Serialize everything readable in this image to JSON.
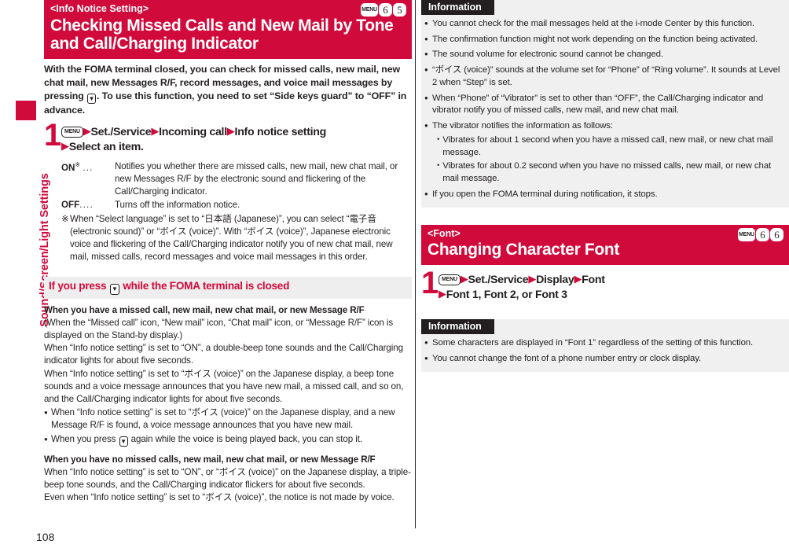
{
  "sidebar": {
    "chapter_label": "Sound/Screen/Light Settings",
    "accent_color": "#d10a3c"
  },
  "page_number": "108",
  "left_column": {
    "section": {
      "eyebrow": "<Info Notice Setting>",
      "title": "Checking Missed Calls and New Mail by Tone and Call/Charging Indicator",
      "menu_badges": [
        "MENU",
        "6",
        "5"
      ]
    },
    "intro_part1": "With the FOMA terminal closed, you can check for missed calls, new mail, new chat mail, new Messages R/F, record messages, and voice mail messages by pressing ",
    "intro_part2": ". To use this function, you need to set “Side keys guard” to “OFF” in advance.",
    "step": {
      "number": "1",
      "menu_key": "MENU",
      "line1_items": [
        "Set./Service",
        "Incoming call",
        "Info notice setting"
      ],
      "line2_item": "Select an item."
    },
    "definitions": [
      {
        "term": "ON",
        "superscript": "※",
        "dots": "...",
        "desc": "Notifies you whether there are missed calls, new mail, new chat mail, or new Messages R/F by the electronic sound and flickering of the Call/Charging indicator."
      },
      {
        "term": "OFF",
        "superscript": "",
        "dots": "....",
        "desc": "Turns off the information notice."
      }
    ],
    "note": {
      "mark": "※",
      "text": "When “Select language” is set to “日本語 (Japanese)”, you can select “電子音 (electronic sound)” or “ボイス (voice)”. With “ボイス (voice)”, Japanese electronic voice and flickering of the Call/Charging indicator notify you of new chat mail, new mail, missed calls, record messages and voice mail messages in this order."
    },
    "subhead": {
      "text_before": "If you press ",
      "text_after": " while the FOMA terminal is closed"
    },
    "blocks": [
      {
        "heading": "When you have a missed call, new mail, new chat mail, or new Message R/F",
        "paragraphs": [
          "(When the “Missed call” icon, “New mail” icon, “Chat mail” icon, or “Message R/F” icon is displayed on the Stand-by display.)",
          "When “Info notice setting” is set to “ON”, a double-beep tone sounds and the Call/Charging indicator lights for about five seconds.",
          "When “Info notice setting” is set to “ボイス (voice)” on the Japanese display, a beep tone sounds and a voice message announces that you have new mail, a missed call, and so on, and the Call/Charging indicator lights for about five seconds."
        ],
        "bullets": [
          {
            "text_before": "When “Info notice setting” is set to “ボイス (voice)” on the Japanese display, and a new Message R/F is found, a voice message announces that you have new mail.",
            "has_key": false,
            "text_after": ""
          },
          {
            "text_before": "When you press ",
            "has_key": true,
            "text_after": " again while the voice is being played back, you can stop it."
          }
        ]
      },
      {
        "heading": "When you have no missed calls, new mail, new chat mail, or new Message R/F",
        "paragraphs": [
          "When “Info notice setting” is set to “ON”, or “ボイス (voice)” on the Japanese display, a triple-beep tone sounds, and the Call/Charging indicator flickers for about five seconds.",
          "Even when “Info notice setting” is set to “ボイス (voice)”, the notice is not made by voice."
        ],
        "bullets": []
      }
    ]
  },
  "right_column": {
    "info_box_1": {
      "title": "Information",
      "items": [
        {
          "text": "You cannot check for the mail messages held at the i-mode Center by this function.",
          "subitems": []
        },
        {
          "text": "The confirmation function might not work depending on the function being activated.",
          "subitems": []
        },
        {
          "text": "The sound volume for electronic sound cannot be changed.",
          "subitems": []
        },
        {
          "text": "“ボイス (voice)” sounds at the volume set for “Phone” of “Ring volume”. It sounds at Level 2 when “Step” is set.",
          "subitems": []
        },
        {
          "text": "When “Phone” of “Vibrator” is set to other than “OFF”, the Call/Charging indicator and vibrator notify you of missed calls, new mail, and new chat mail.",
          "subitems": []
        },
        {
          "text": "The vibrator notifies the information as follows:",
          "subitems": [
            "Vibrates for about 1 second when you have a missed call, new mail, or new chat mail message.",
            "Vibrates for about 0.2 second when you have no missed calls, new mail, or new chat mail message."
          ]
        },
        {
          "text": "If you open the FOMA terminal during notification, it stops.",
          "subitems": []
        }
      ]
    },
    "section": {
      "eyebrow": "<Font>",
      "title": "Changing Character Font",
      "menu_badges": [
        "MENU",
        "6",
        "6"
      ]
    },
    "step": {
      "number": "1",
      "menu_key": "MENU",
      "line1_items": [
        "Set./Service",
        "Display",
        "Font"
      ],
      "line2_item": "Font 1, Font 2, or Font 3"
    },
    "info_box_2": {
      "title": "Information",
      "items": [
        {
          "text": "Some characters are displayed in “Font 1” regardless of the setting of this function.",
          "subitems": []
        },
        {
          "text": "You cannot change the font of a phone number entry or clock display.",
          "subitems": []
        }
      ]
    }
  }
}
